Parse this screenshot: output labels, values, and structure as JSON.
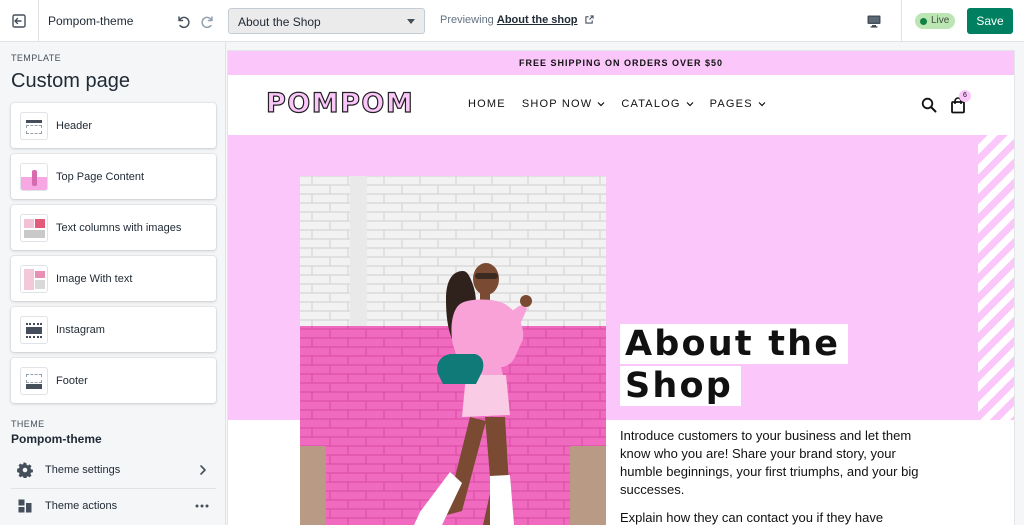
{
  "topbar": {
    "theme_name": "Pompom-theme",
    "page_select": "About the Shop",
    "preview_prefix": "Previewing",
    "preview_link": "About the shop",
    "live_label": "Live",
    "save_label": "Save"
  },
  "sidebar": {
    "template_label": "TEMPLATE",
    "page_title": "Custom page",
    "sections": [
      {
        "label": "Header",
        "icon": "header-layout-icon"
      },
      {
        "label": "Top Page Content",
        "icon": "image-thumbnail"
      },
      {
        "label": "Text columns with images",
        "icon": "image-thumbnail"
      },
      {
        "label": "Image With text",
        "icon": "image-thumbnail"
      },
      {
        "label": "Instagram",
        "icon": "grid-layout-icon"
      },
      {
        "label": "Footer",
        "icon": "footer-layout-icon"
      }
    ],
    "theme_label": "THEME",
    "theme_name": "Pompom-theme",
    "theme_settings": "Theme settings",
    "theme_actions": "Theme actions"
  },
  "store": {
    "announcement": "FREE SHIPPING ON ORDERS OVER $50",
    "logo": "POMPOM",
    "nav": [
      {
        "label": "HOME",
        "has_dropdown": false
      },
      {
        "label": "SHOP NOW",
        "has_dropdown": true
      },
      {
        "label": "CATALOG",
        "has_dropdown": true
      },
      {
        "label": "PAGES",
        "has_dropdown": true
      }
    ],
    "cart_count": "6",
    "hero": {
      "title_line1": "About the",
      "title_line2": "Shop",
      "paragraph1": "Introduce customers to your business and let them know who you are! Share your brand story, your humble beginnings, your first triumphs, and your big successes.",
      "paragraph2": "Explain how they can contact you if they have"
    }
  },
  "colors": {
    "accent_pink": "#fbc7fb",
    "save_green": "#008060",
    "live_green": "#bbe5b3",
    "sidebar_bg": "#f4f6f8"
  }
}
